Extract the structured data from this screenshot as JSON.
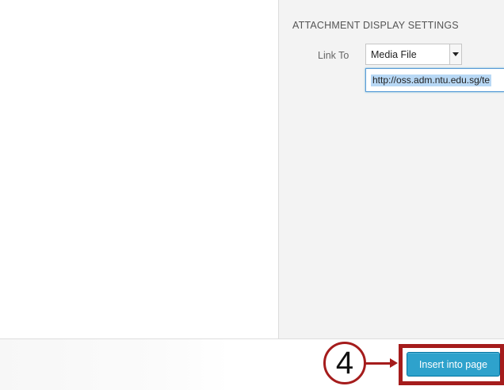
{
  "attachment_settings": {
    "heading": "ATTACHMENT DISPLAY SETTINGS",
    "link_to_label": "Link To",
    "link_to_value": "Media File",
    "url_value": "http://oss.adm.ntu.edu.sg/te"
  },
  "annotation": {
    "step_number": "4",
    "color": "#a51c1c"
  },
  "footer": {
    "insert_button_label": "Insert into page",
    "button_color": "#2ea2cc"
  }
}
